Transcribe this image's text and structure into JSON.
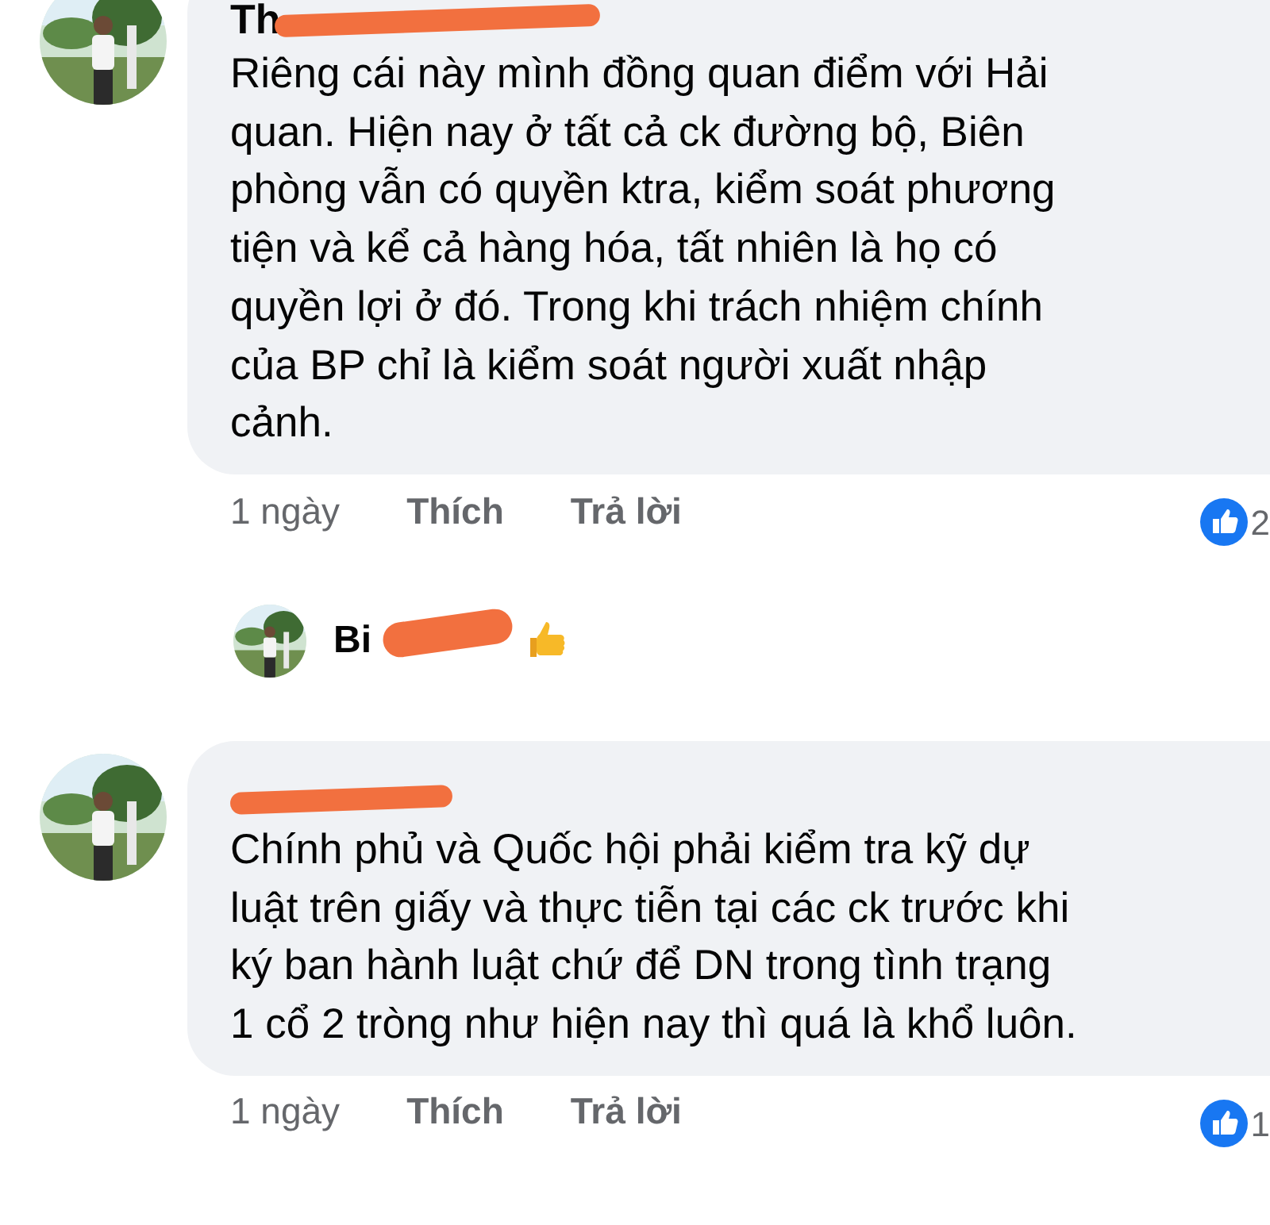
{
  "comments": [
    {
      "kind": "comment",
      "author": "Th",
      "text": "Riêng cái này mình đồng quan điểm với Hải\nquan. Hiện nay ở tất cả ck đường bộ, Biên\nphòng vẫn có quyền ktra, kiểm soát phương\ntiện và kể cả hàng hóa,  tất nhiên là họ có\nquyền lợi ở đó. Trong khi trách nhiệm chính\ncủa BP chỉ là kiểm soát người xuất nhập\ncảnh.",
      "time": "1 ngày",
      "actions": [
        "Thích",
        "Trả lời"
      ],
      "reaction_count": "2"
    },
    {
      "kind": "reply",
      "author": "Bi"
    },
    {
      "kind": "comment",
      "text": "Chính phủ và Quốc hội phải kiểm tra kỹ dự\nluật trên giấy và thực tiễn tại các ck trước khi\nký ban hành luật chứ để DN trong tình trạng\n1 cổ 2 tròng như hiện nay thì quá là khổ luôn.",
      "time": "1 ngày",
      "actions": [
        "Thích",
        "Trả lời"
      ],
      "reaction_count": "1"
    }
  ]
}
